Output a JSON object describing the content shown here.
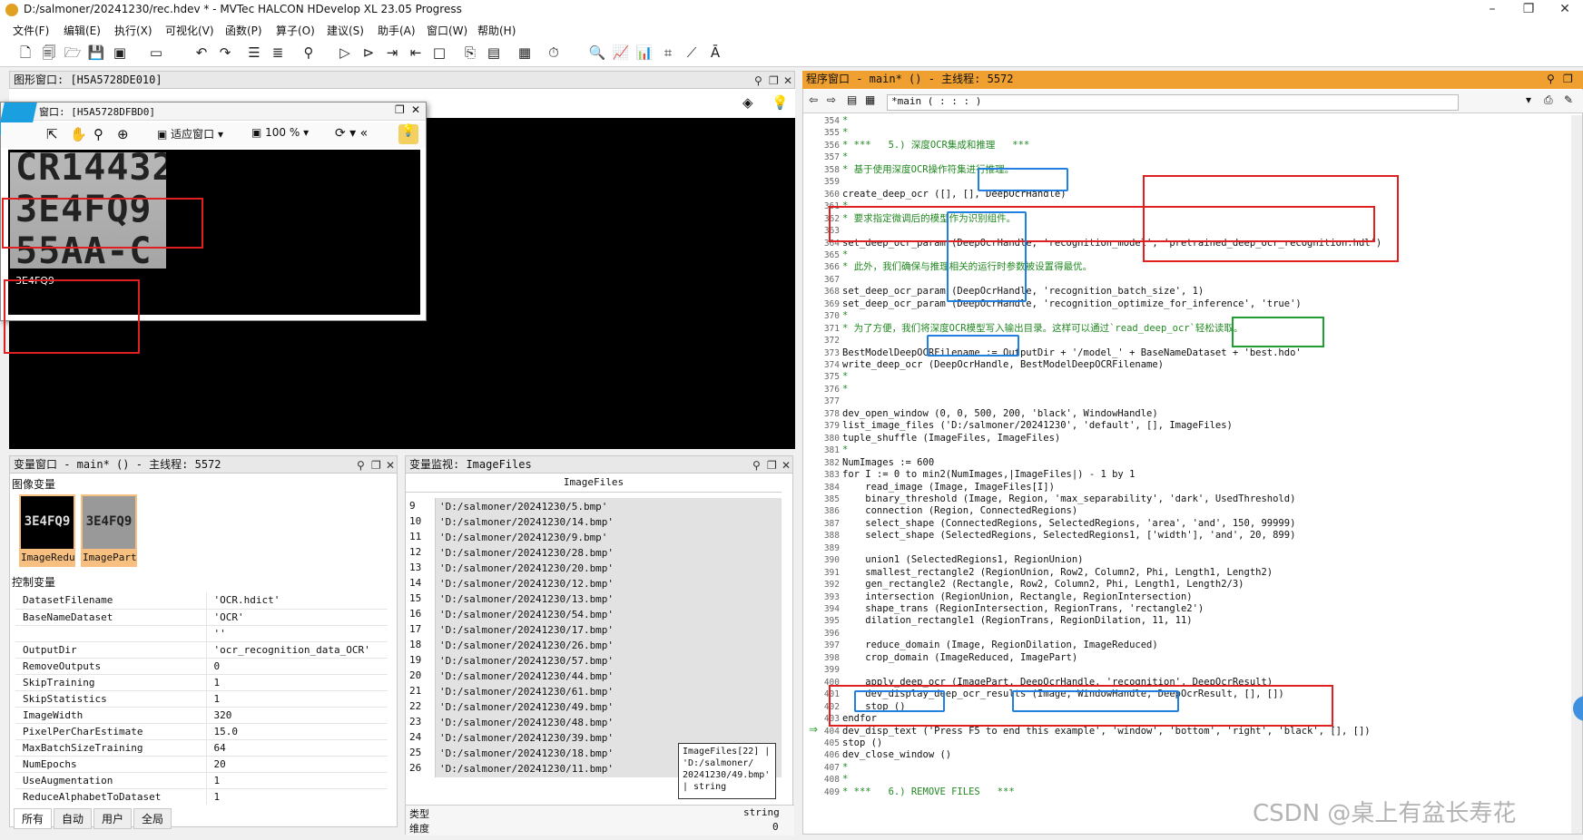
{
  "window": {
    "title": "D:/salmoner/20241230/rec.hdev * - MVTec HALCON HDevelop XL 23.05 Progress"
  },
  "menu": [
    "文件(F)",
    "编辑(E)",
    "执行(X)",
    "可视化(V)",
    "函数(P)",
    "算子(O)",
    "建议(S)",
    "助手(A)",
    "窗口(W)",
    "帮助(H)"
  ],
  "graphics_window": {
    "title": "图形窗口: [H5A5728DE010]",
    "float_title": "窗口: [H5A5728DFBD0]",
    "fit_label": "适应窗口",
    "zoom": "100 %",
    "ocr_lines": [
      "CR14432",
      "3E4FQ9",
      "55AA-C"
    ],
    "result_label": "3E4FQ9"
  },
  "variable_window": {
    "title": "变量窗口 - main* () - 主线程: 5572",
    "image_section": "图像变量",
    "images": [
      {
        "label": "ImageRedu",
        "text": "3E4FQ9"
      },
      {
        "label": "ImagePart",
        "text": "3E4FQ9"
      }
    ],
    "control_section": "控制变量",
    "controls": [
      {
        "name": "DatasetFilename",
        "value": "'OCR.hdict'"
      },
      {
        "name": "BaseNameDataset",
        "value": "'OCR'"
      },
      {
        "name": "",
        "value": "''"
      },
      {
        "name": "OutputDir",
        "value": "'ocr_recognition_data_OCR'"
      },
      {
        "name": "RemoveOutputs",
        "value": "0"
      },
      {
        "name": "SkipTraining",
        "value": "1"
      },
      {
        "name": "SkipStatistics",
        "value": "1"
      },
      {
        "name": "ImageWidth",
        "value": "320"
      },
      {
        "name": "PixelPerCharEstimate",
        "value": "15.0"
      },
      {
        "name": "MaxBatchSizeTraining",
        "value": "64"
      },
      {
        "name": "NumEpochs",
        "value": "20"
      },
      {
        "name": "UseAugmentation",
        "value": "1"
      },
      {
        "name": "ReduceAlphabetToDataset",
        "value": "1"
      }
    ],
    "tabs": [
      "所有",
      "自动",
      "用户",
      "全局"
    ]
  },
  "watch_window": {
    "title": "变量监视: ImageFiles",
    "column": "ImageFiles",
    "rows": [
      {
        "i": "9",
        "v": "'D:/salmoner/20241230/5.bmp'"
      },
      {
        "i": "10",
        "v": "'D:/salmoner/20241230/14.bmp'"
      },
      {
        "i": "11",
        "v": "'D:/salmoner/20241230/9.bmp'"
      },
      {
        "i": "12",
        "v": "'D:/salmoner/20241230/28.bmp'"
      },
      {
        "i": "13",
        "v": "'D:/salmoner/20241230/20.bmp'"
      },
      {
        "i": "14",
        "v": "'D:/salmoner/20241230/12.bmp'"
      },
      {
        "i": "15",
        "v": "'D:/salmoner/20241230/13.bmp'"
      },
      {
        "i": "16",
        "v": "'D:/salmoner/20241230/54.bmp'"
      },
      {
        "i": "17",
        "v": "'D:/salmoner/20241230/17.bmp'"
      },
      {
        "i": "18",
        "v": "'D:/salmoner/20241230/26.bmp'"
      },
      {
        "i": "19",
        "v": "'D:/salmoner/20241230/57.bmp'"
      },
      {
        "i": "20",
        "v": "'D:/salmoner/20241230/44.bmp'"
      },
      {
        "i": "21",
        "v": "'D:/salmoner/20241230/61.bmp'"
      },
      {
        "i": "22",
        "v": "'D:/salmoner/20241230/49.bmp'"
      },
      {
        "i": "23",
        "v": "'D:/salmoner/20241230/48.bmp'"
      },
      {
        "i": "24",
        "v": "'D:/salmoner/20241230/39.bmp'"
      },
      {
        "i": "25",
        "v": "'D:/salmoner/20241230/18.bmp'"
      },
      {
        "i": "26",
        "v": "'D:/salmoner/20241230/11.bmp'"
      }
    ],
    "tooltip": "ImageFiles[22] | 'D:/salmoner/ 20241230/49.bmp' | string",
    "footer_type_label": "类型",
    "footer_type_value": "string",
    "footer_dim_label": "维度",
    "footer_dim_value": "0"
  },
  "program_window": {
    "title": "程序窗口 - main* () - 主线程: 5572",
    "proc": "*main ( : : : )",
    "lines": [
      {
        "n": "354",
        "t": "*",
        "c": true
      },
      {
        "n": "355",
        "t": "*",
        "c": true
      },
      {
        "n": "356",
        "t": "* ***   5.) 深度OCR集成和推理   ***",
        "c": true
      },
      {
        "n": "357",
        "t": "*",
        "c": true
      },
      {
        "n": "358",
        "t": "* 基于使用深度OCR操作符集进行推理。",
        "c": true
      },
      {
        "n": "359",
        "t": "",
        "c": false
      },
      {
        "n": "360",
        "t": "create_deep_ocr ([], [], DeepOcrHandle)",
        "c": false
      },
      {
        "n": "361",
        "t": "*",
        "c": true
      },
      {
        "n": "362",
        "t": "* 要求指定微调后的模型作为识别组件。",
        "c": true
      },
      {
        "n": "363",
        "t": "",
        "c": false
      },
      {
        "n": "364",
        "t": "set_deep_ocr_param (DeepOcrHandle, 'recognition_model', 'pretrained_deep_ocr_recognition.hdl')",
        "c": false
      },
      {
        "n": "365",
        "t": "*",
        "c": true
      },
      {
        "n": "366",
        "t": "* 此外，我们确保与推理相关的运行时参数被设置得最优。",
        "c": true
      },
      {
        "n": "367",
        "t": "",
        "c": false
      },
      {
        "n": "368",
        "t": "set_deep_ocr_param (DeepOcrHandle, 'recognition_batch_size', 1)",
        "c": false
      },
      {
        "n": "369",
        "t": "set_deep_ocr_param (DeepOcrHandle, 'recognition_optimize_for_inference', 'true')",
        "c": false
      },
      {
        "n": "370",
        "t": "*",
        "c": true
      },
      {
        "n": "371",
        "t": "* 为了方便，我们将深度OCR模型写入输出目录。这样可以通过`read_deep_ocr`轻松读取。",
        "c": true
      },
      {
        "n": "372",
        "t": "",
        "c": false
      },
      {
        "n": "373",
        "t": "BestModelDeepOCRFilename := OutputDir + '/model_' + BaseNameDataset + 'best.hdo'",
        "c": false
      },
      {
        "n": "374",
        "t": "write_deep_ocr (DeepOcrHandle, BestModelDeepOCRFilename)",
        "c": false
      },
      {
        "n": "375",
        "t": "*",
        "c": true
      },
      {
        "n": "376",
        "t": "*",
        "c": true
      },
      {
        "n": "377",
        "t": "",
        "c": false
      },
      {
        "n": "378",
        "t": "dev_open_window (0, 0, 500, 200, 'black', WindowHandle)",
        "c": false
      },
      {
        "n": "379",
        "t": "list_image_files ('D:/salmoner/20241230', 'default', [], ImageFiles)",
        "c": false
      },
      {
        "n": "380",
        "t": "tuple_shuffle (ImageFiles, ImageFiles)",
        "c": false
      },
      {
        "n": "381",
        "t": "*",
        "c": true
      },
      {
        "n": "382",
        "t": "NumImages := 600",
        "c": false
      },
      {
        "n": "383",
        "t": "for I := 0 to min2(NumImages,|ImageFiles|) - 1 by 1",
        "c": false
      },
      {
        "n": "384",
        "t": "    read_image (Image, ImageFiles[I])",
        "c": false
      },
      {
        "n": "385",
        "t": "    binary_threshold (Image, Region, 'max_separability', 'dark', UsedThreshold)",
        "c": false
      },
      {
        "n": "386",
        "t": "    connection (Region, ConnectedRegions)",
        "c": false
      },
      {
        "n": "387",
        "t": "    select_shape (ConnectedRegions, SelectedRegions, 'area', 'and', 150, 99999)",
        "c": false
      },
      {
        "n": "388",
        "t": "    select_shape (SelectedRegions, SelectedRegions1, ['width'], 'and', 20, 899)",
        "c": false
      },
      {
        "n": "389",
        "t": "",
        "c": false
      },
      {
        "n": "390",
        "t": "    union1 (SelectedRegions1, RegionUnion)",
        "c": false
      },
      {
        "n": "391",
        "t": "    smallest_rectangle2 (RegionUnion, Row2, Column2, Phi, Length1, Length2)",
        "c": false
      },
      {
        "n": "392",
        "t": "    gen_rectangle2 (Rectangle, Row2, Column2, Phi, Length1, Length2/3)",
        "c": false
      },
      {
        "n": "393",
        "t": "    intersection (RegionUnion, Rectangle, RegionIntersection)",
        "c": false
      },
      {
        "n": "394",
        "t": "    shape_trans (RegionIntersection, RegionTrans, 'rectangle2')",
        "c": false
      },
      {
        "n": "395",
        "t": "    dilation_rectangle1 (RegionTrans, RegionDilation, 11, 11)",
        "c": false
      },
      {
        "n": "396",
        "t": "",
        "c": false
      },
      {
        "n": "397",
        "t": "    reduce_domain (Image, RegionDilation, ImageReduced)",
        "c": false
      },
      {
        "n": "398",
        "t": "    crop_domain (ImageReduced, ImagePart)",
        "c": false
      },
      {
        "n": "399",
        "t": "",
        "c": false
      },
      {
        "n": "400",
        "t": "    apply_deep_ocr (ImagePart, DeepOcrHandle, 'recognition', DeepOcrResult)",
        "c": false
      },
      {
        "n": "401",
        "t": "    dev_display_deep_ocr_results (Image, WindowHandle, DeepOcrResult, [], [])",
        "c": false
      },
      {
        "n": "402",
        "t": "    stop ()",
        "c": false
      },
      {
        "n": "403",
        "t": "endfor",
        "c": false
      },
      {
        "n": "404",
        "t": "dev_disp_text ('Press F5 to end this example', 'window', 'bottom', 'right', 'black', [], [])",
        "c": false
      },
      {
        "n": "405",
        "t": "stop ()",
        "c": false
      },
      {
        "n": "406",
        "t": "dev_close_window ()",
        "c": false
      },
      {
        "n": "407",
        "t": "*",
        "c": true
      },
      {
        "n": "408",
        "t": "*",
        "c": true
      },
      {
        "n": "409",
        "t": "* ***   6.) REMOVE FILES   ***",
        "c": true
      }
    ]
  },
  "watermark": "CSDN @桌上有盆长寿花",
  "colors": {
    "accent": "#f0a030",
    "red": "#e02020",
    "blue": "#2080e0",
    "green": "#20a030"
  }
}
